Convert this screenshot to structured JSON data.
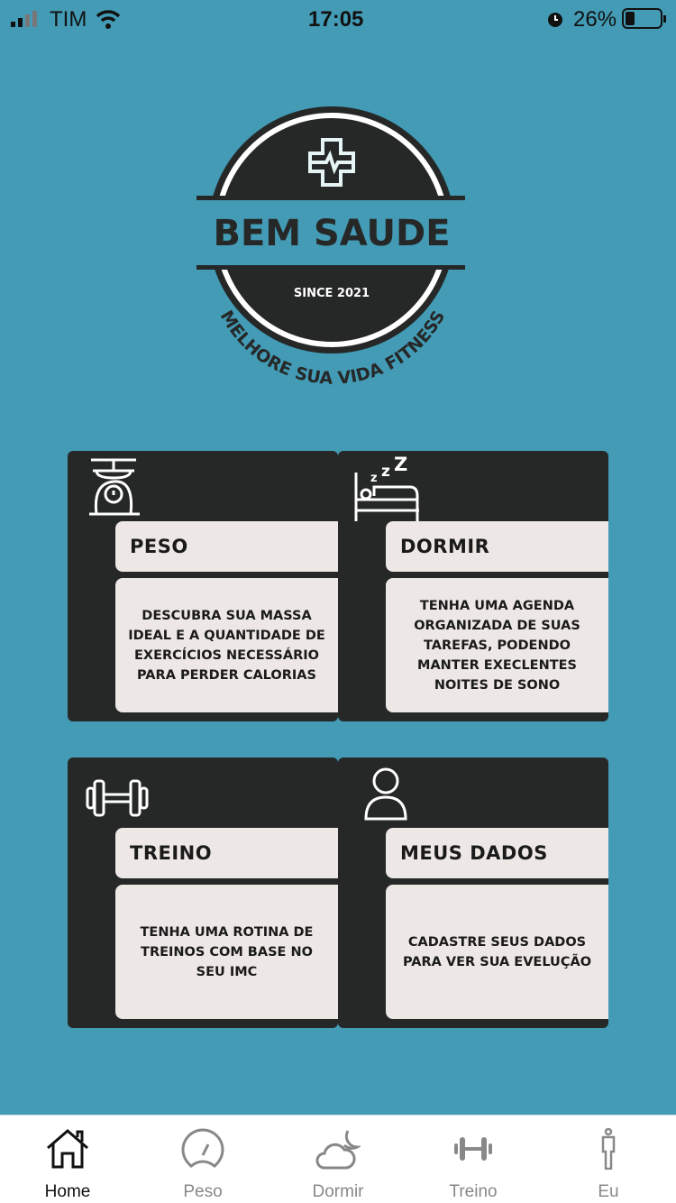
{
  "status": {
    "carrier": "TIM",
    "time": "17:05",
    "battery": "26%"
  },
  "logo": {
    "title": "BEM SAUDE",
    "since": "SINCE 2021",
    "slogan": "MELHORE SUA VIDA FITNESS"
  },
  "cards": [
    {
      "title": "PESO",
      "desc": "Descubra sua massa ideal e a quantidade de exercícios necessário para perder calorias",
      "icon": "scale-icon"
    },
    {
      "title": "DORMIR",
      "desc": "Tenha uma agenda organizada de suas tarefas, podendo manter execlentes noites de sono",
      "icon": "bed-icon"
    },
    {
      "title": "TREINO",
      "desc": "Tenha uma rotina de treinos com base no seu IMC",
      "icon": "dumbbell-icon"
    },
    {
      "title": "MEUS DADOS",
      "desc": "Cadastre seus dados para ver sua evelução",
      "icon": "user-icon"
    }
  ],
  "tabs": [
    {
      "label": "Home"
    },
    {
      "label": "Peso"
    },
    {
      "label": "Dormir"
    },
    {
      "label": "Treino"
    },
    {
      "label": "Eu"
    }
  ],
  "colors": {
    "background": "#439bb5",
    "card": "#262828",
    "panel": "#ede8e6"
  }
}
